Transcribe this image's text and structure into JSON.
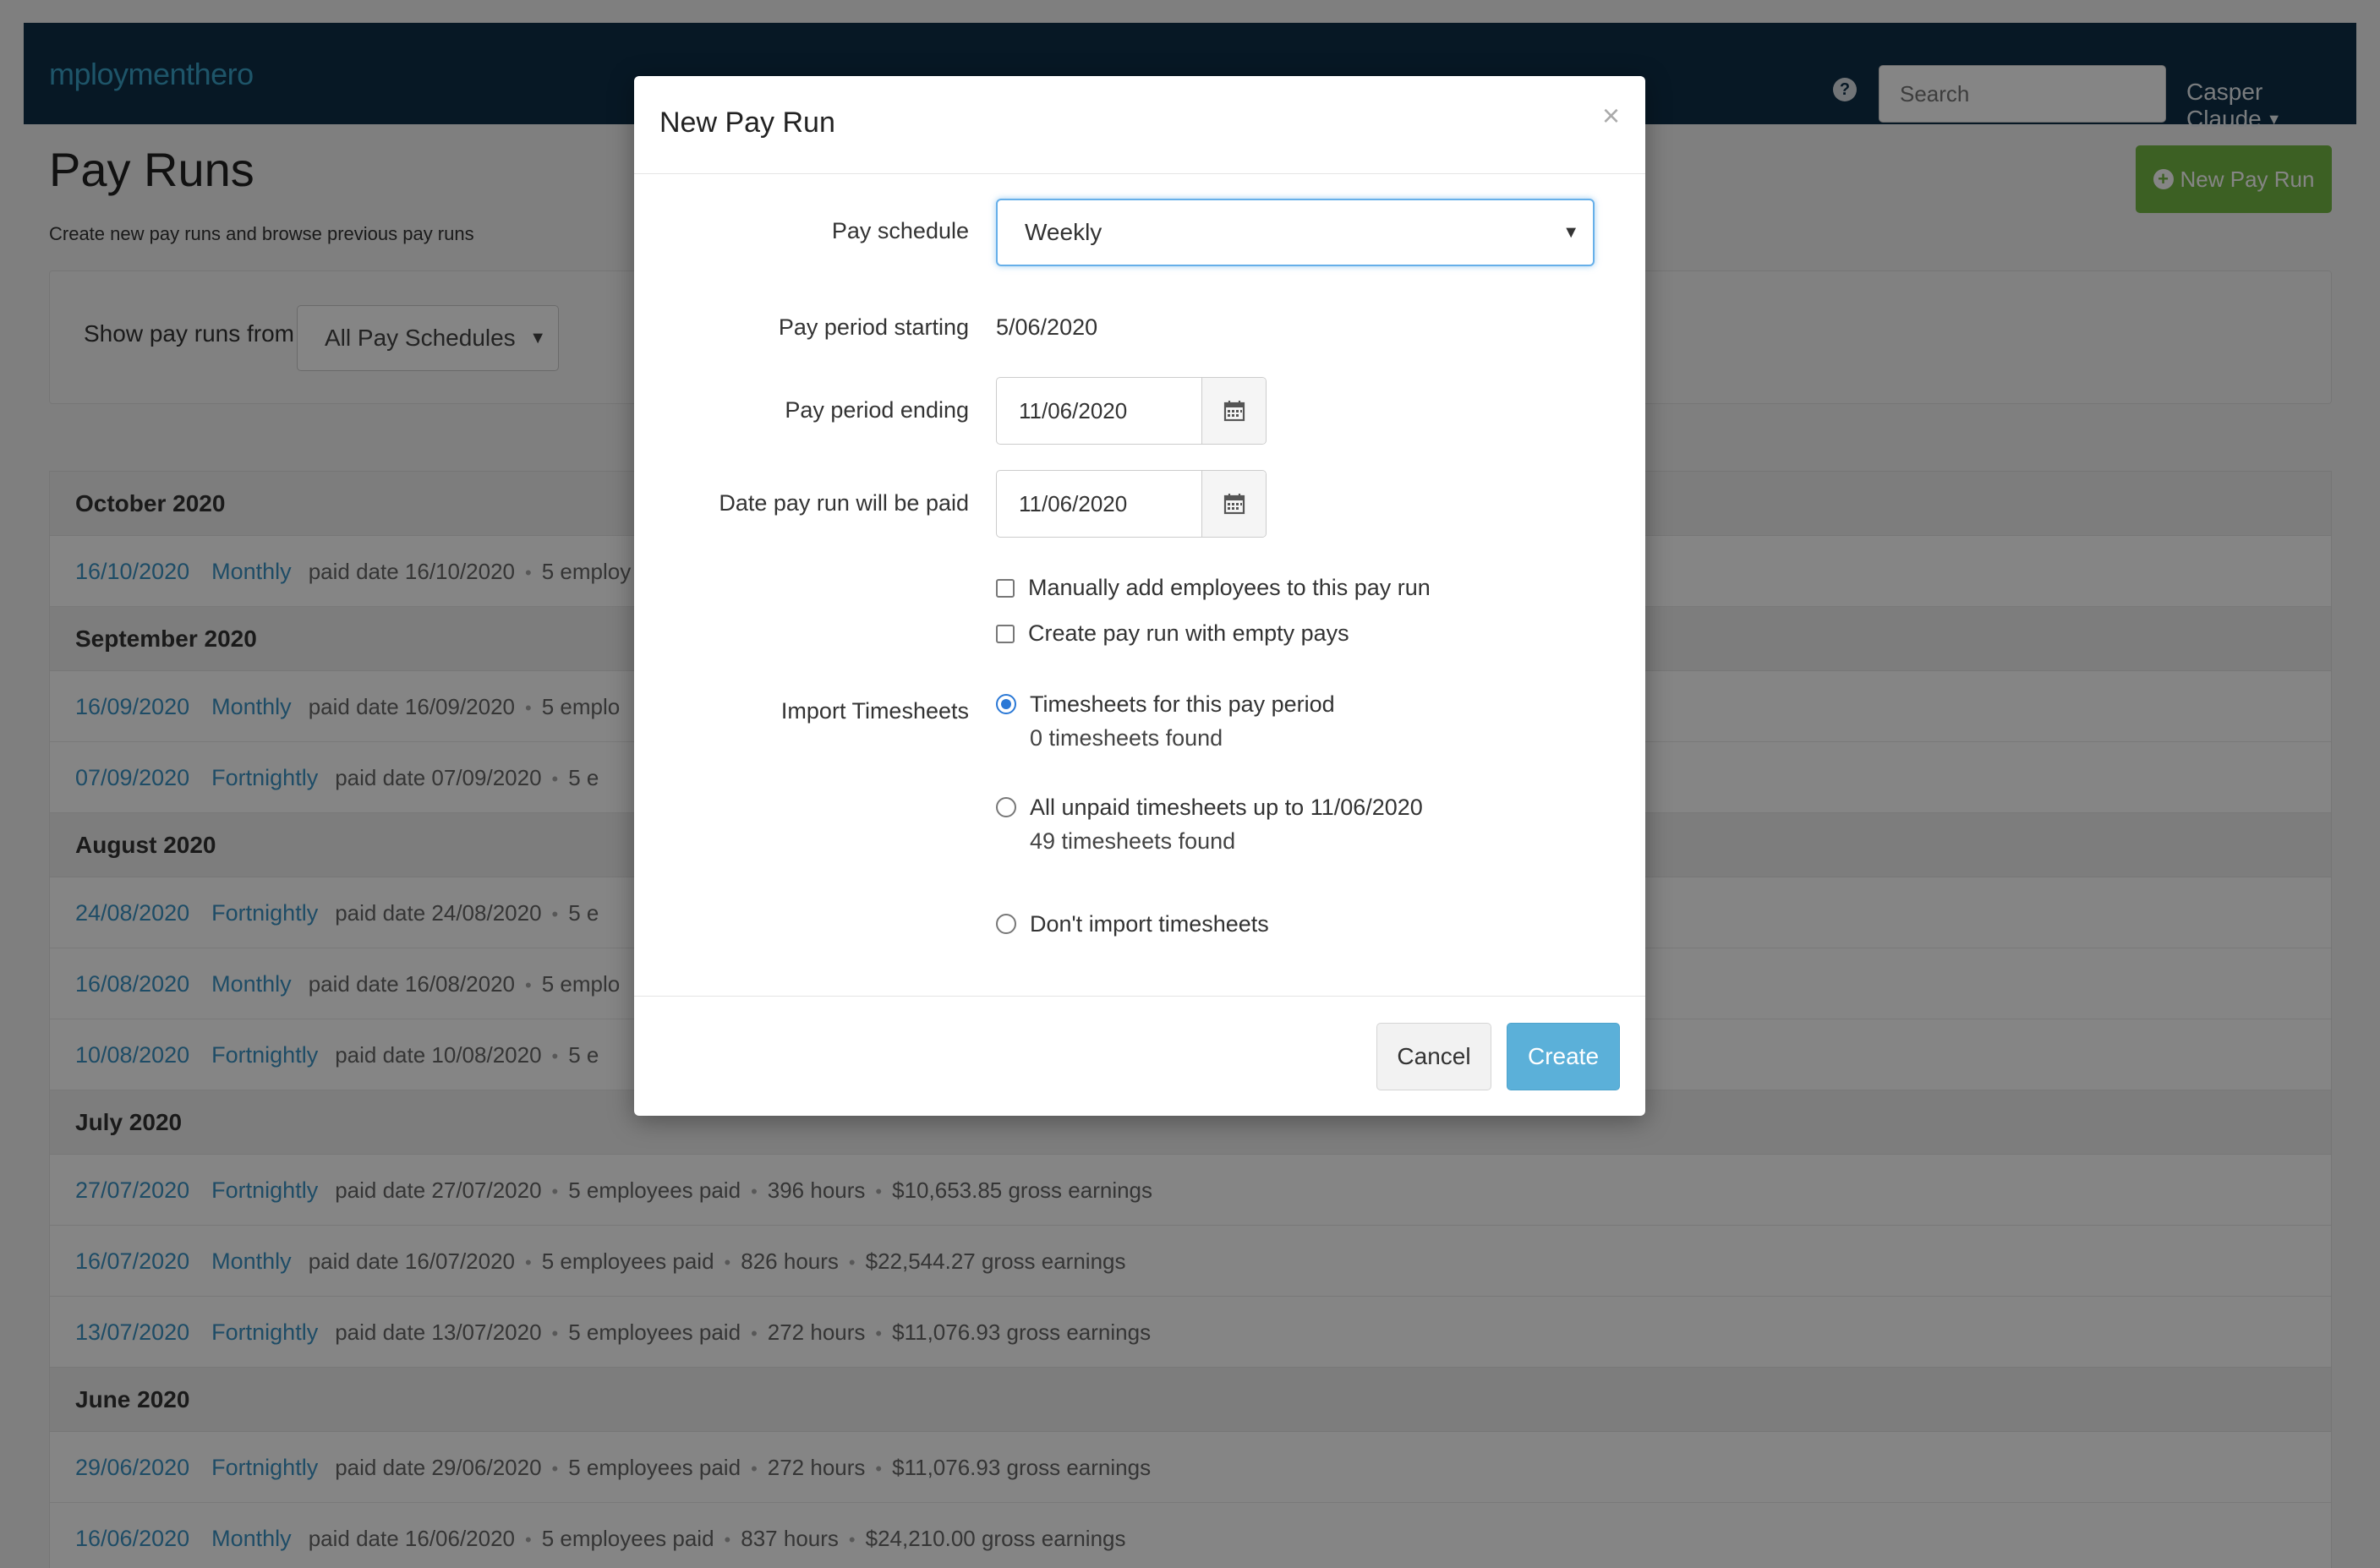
{
  "app": {
    "logo_text": "mploymenthero",
    "search_placeholder": "Search",
    "user_name": "Casper Claude"
  },
  "page": {
    "title": "Pay Runs",
    "subtitle": "Create new pay runs and browse previous pay runs",
    "new_pay_run_label": "New Pay Run",
    "filter_label": "Show pay runs from",
    "filter_value": "All Pay Schedules"
  },
  "runs": [
    {
      "month": "October 2020",
      "rows": [
        {
          "date": "16/10/2020",
          "schedule": "Monthly",
          "paid": "paid date 16/10/2020",
          "employees": "5 employ",
          "hours": "",
          "earnings": ""
        }
      ]
    },
    {
      "month": "September 2020",
      "rows": [
        {
          "date": "16/09/2020",
          "schedule": "Monthly",
          "paid": "paid date 16/09/2020",
          "employees": "5 emplo",
          "hours": "",
          "earnings": ""
        },
        {
          "date": "07/09/2020",
          "schedule": "Fortnightly",
          "paid": "paid date 07/09/2020",
          "employees": "5 e",
          "hours": "",
          "earnings": ""
        }
      ]
    },
    {
      "month": "August 2020",
      "rows": [
        {
          "date": "24/08/2020",
          "schedule": "Fortnightly",
          "paid": "paid date 24/08/2020",
          "employees": "5 e",
          "hours": "",
          "earnings": ""
        },
        {
          "date": "16/08/2020",
          "schedule": "Monthly",
          "paid": "paid date 16/08/2020",
          "employees": "5 emplo",
          "hours": "",
          "earnings": ""
        },
        {
          "date": "10/08/2020",
          "schedule": "Fortnightly",
          "paid": "paid date 10/08/2020",
          "employees": "5 e",
          "hours": "",
          "earnings": ""
        }
      ]
    },
    {
      "month": "July 2020",
      "rows": [
        {
          "date": "27/07/2020",
          "schedule": "Fortnightly",
          "paid": "paid date 27/07/2020",
          "employees": "5 employees paid",
          "hours": "396 hours",
          "earnings": "$10,653.85 gross earnings"
        },
        {
          "date": "16/07/2020",
          "schedule": "Monthly",
          "paid": "paid date 16/07/2020",
          "employees": "5 employees paid",
          "hours": "826 hours",
          "earnings": "$22,544.27 gross earnings"
        },
        {
          "date": "13/07/2020",
          "schedule": "Fortnightly",
          "paid": "paid date 13/07/2020",
          "employees": "5 employees paid",
          "hours": "272 hours",
          "earnings": "$11,076.93 gross earnings"
        }
      ]
    },
    {
      "month": "June 2020",
      "rows": [
        {
          "date": "29/06/2020",
          "schedule": "Fortnightly",
          "paid": "paid date 29/06/2020",
          "employees": "5 employees paid",
          "hours": "272 hours",
          "earnings": "$11,076.93 gross earnings"
        },
        {
          "date": "16/06/2020",
          "schedule": "Monthly",
          "paid": "paid date 16/06/2020",
          "employees": "5 employees paid",
          "hours": "837 hours",
          "earnings": "$24,210.00 gross earnings"
        }
      ]
    }
  ],
  "modal": {
    "title": "New Pay Run",
    "close_symbol": "×",
    "pay_schedule_label": "Pay schedule",
    "pay_schedule_value": "Weekly",
    "period_start_label": "Pay period starting",
    "period_start_value": "5/06/2020",
    "period_end_label": "Pay period ending",
    "period_end_value": "11/06/2020",
    "paid_date_label": "Date pay run will be paid",
    "paid_date_value": "11/06/2020",
    "manual_add_label": "Manually add employees to this pay run",
    "empty_pays_label": "Create pay run with empty pays",
    "import_label": "Import Timesheets",
    "option_period": "Timesheets for this pay period",
    "option_period_count": "0 timesheets found",
    "option_unpaid": "All unpaid timesheets up to 11/06/2020",
    "option_unpaid_count": "49 timesheets found",
    "option_none": "Don't import timesheets",
    "cancel_label": "Cancel",
    "create_label": "Create"
  },
  "colors": {
    "topbar": "#0f2e47",
    "accent_blue": "#3a93c4",
    "primary_button": "#5bb0d9",
    "success_button": "#74b843"
  }
}
